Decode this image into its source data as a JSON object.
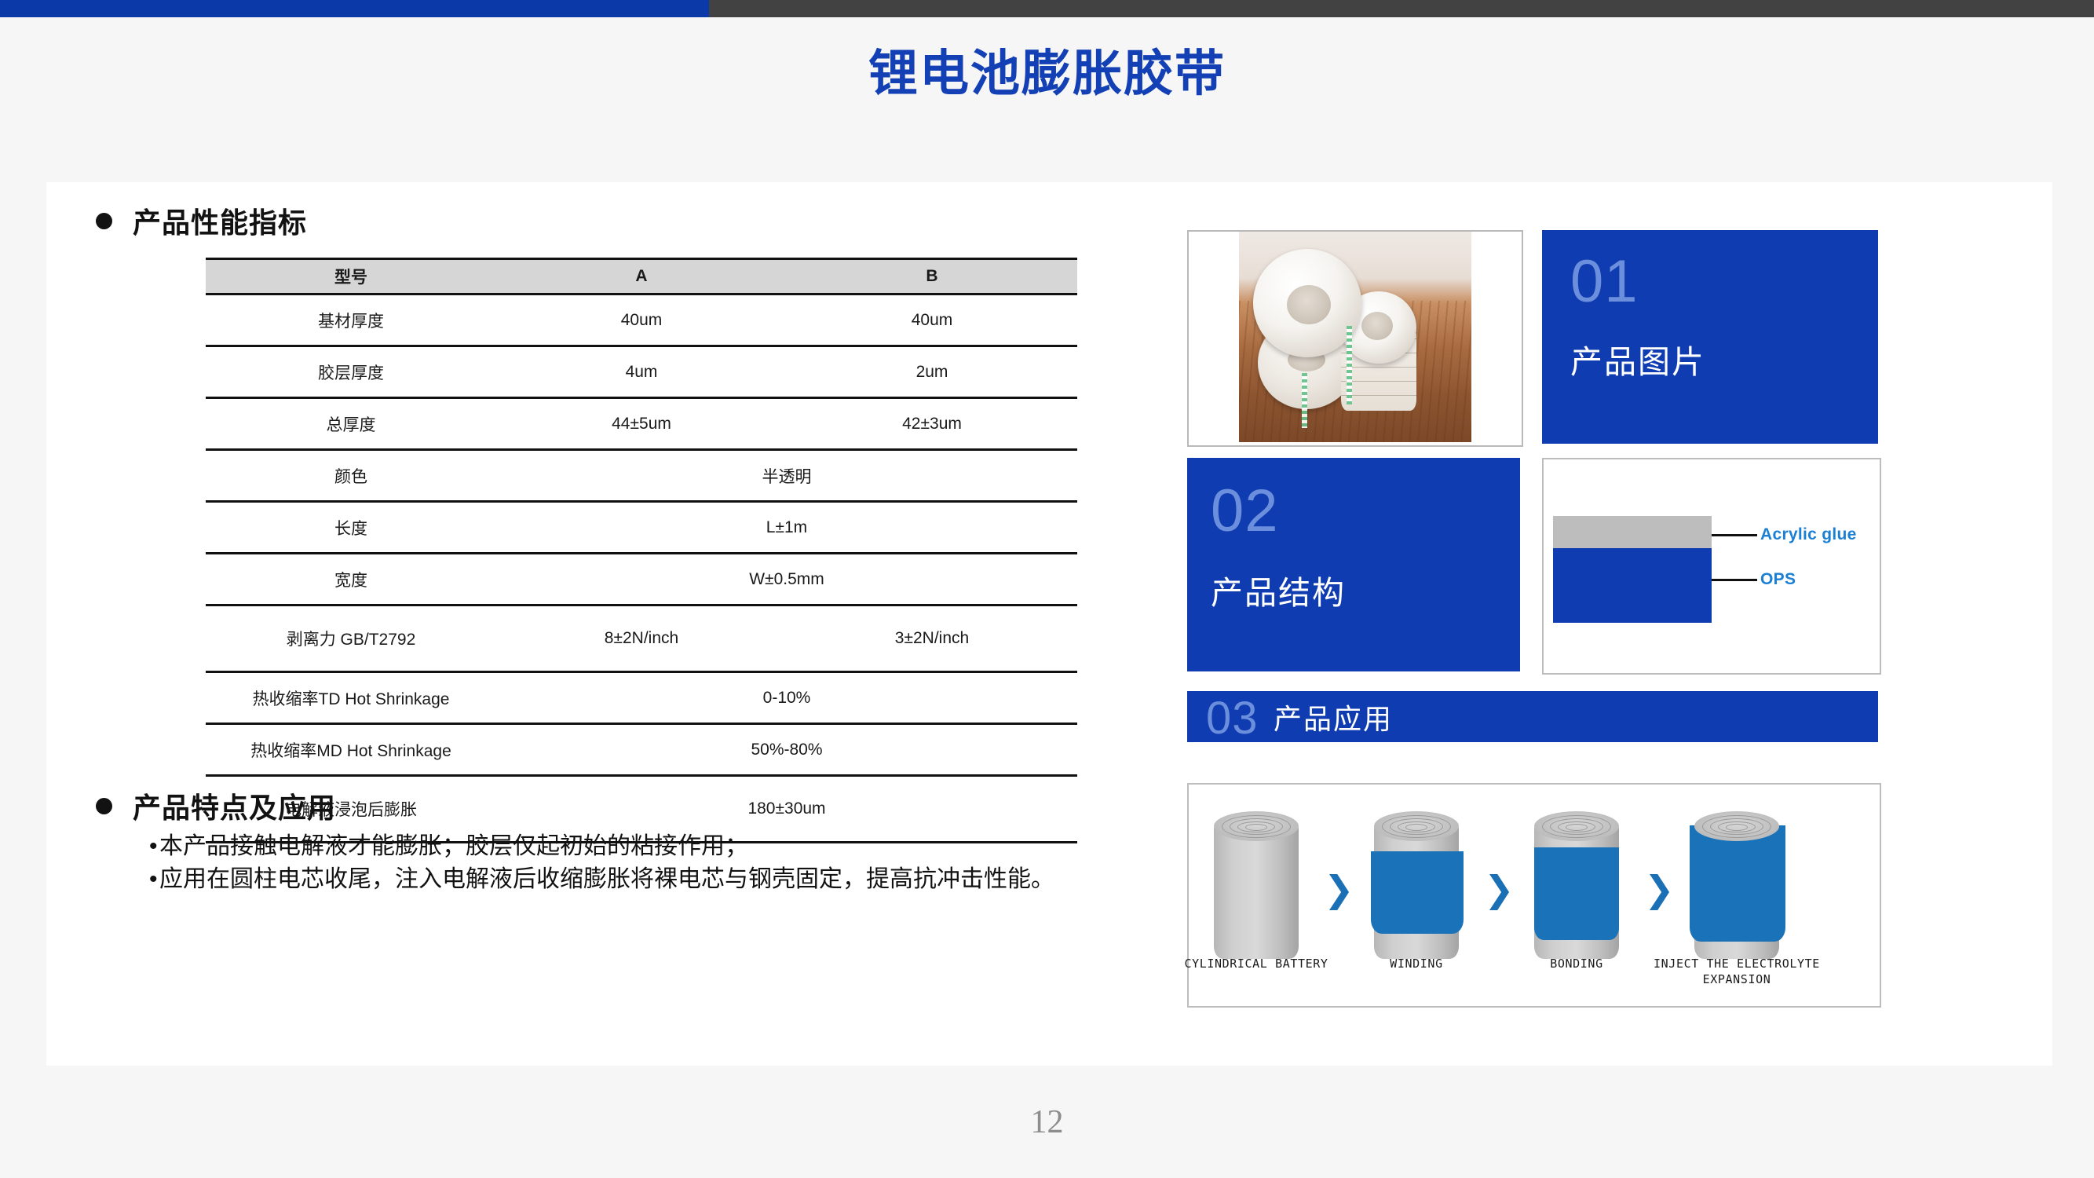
{
  "topbar": {
    "blue_color": "#0b3aa8",
    "dark_color": "#424242"
  },
  "title": "锂电池膨胀胶带",
  "page_number": "12",
  "sections": {
    "performance_heading": "产品性能指标",
    "features_heading": "产品特点及应用"
  },
  "spec_table": {
    "headers": [
      "型号",
      "A",
      "B"
    ],
    "rows": [
      {
        "name": "基材厚度",
        "a": "40um",
        "b": "40um",
        "merged": false
      },
      {
        "name": "胶层厚度",
        "a": "4um",
        "b": "2um",
        "merged": false
      },
      {
        "name": "总厚度",
        "a": "44±5um",
        "b": "42±3um",
        "merged": false
      },
      {
        "name": "颜色",
        "value": "半透明",
        "merged": true
      },
      {
        "name": "长度",
        "value": "L±1m",
        "merged": true
      },
      {
        "name": "宽度",
        "value": "W±0.5mm",
        "merged": true
      },
      {
        "name": "剥离力 GB/T2792",
        "a": "8±2N/inch",
        "b": "3±2N/inch",
        "merged": false
      },
      {
        "name": "热收缩率TD Hot Shrinkage",
        "value": "0-10%",
        "merged": true
      },
      {
        "name": "热收缩率MD Hot Shrinkage",
        "value": "50%-80%",
        "merged": true
      },
      {
        "name": "电解液浸泡后膨胀",
        "value": "180±30um",
        "merged": true
      }
    ]
  },
  "features": [
    "本产品接触电解液才能膨胀；胶层仅起初始的粘接作用；",
    "应用在圆柱电芯收尾，注入电解液后收缩膨胀将裸电芯与钢壳固定，提高抗冲击性能。"
  ],
  "panels": {
    "picture": {
      "number": "01",
      "label": "产品图片"
    },
    "structure": {
      "number": "02",
      "label": "产品结构"
    },
    "application": {
      "number": "03",
      "label": "产品应用"
    }
  },
  "structure_diagram": {
    "glue_label": "Acrylic glue",
    "ops_label": "OPS",
    "glue_color": "#bdbdbd",
    "ops_color": "#0f3cb0",
    "label_color": "#1b7fd4"
  },
  "application_diagram": {
    "steps": [
      {
        "caption": "CYLINDRICAL BATTERY"
      },
      {
        "caption": "WINDING"
      },
      {
        "caption": "BONDING"
      },
      {
        "caption": "INJECT THE ELECTROLYTE EXPANSION"
      }
    ],
    "arrow_glyph": "❯",
    "tape_color": "#1a72b8",
    "battery_color": "#cfcfcf"
  }
}
